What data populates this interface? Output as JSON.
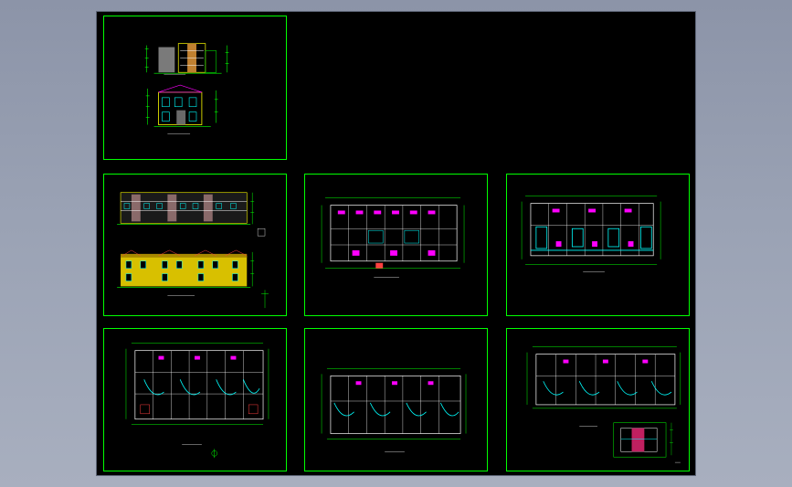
{
  "viewer": {
    "background_color": "#9aa2b4",
    "canvas_color": "#000000",
    "sheet_border_color": "#00ff00"
  },
  "sheets": [
    {
      "id": "sheet-1",
      "kind": "side-elevations"
    },
    {
      "id": "sheet-2",
      "kind": "front-and-rear-elevations"
    },
    {
      "id": "sheet-3",
      "kind": "floor-plan"
    },
    {
      "id": "sheet-4",
      "kind": "floor-plan"
    },
    {
      "id": "sheet-5",
      "kind": "floor-plan"
    },
    {
      "id": "sheet-6",
      "kind": "floor-plan"
    },
    {
      "id": "sheet-7",
      "kind": "floor-plan-with-detail"
    }
  ],
  "colors": {
    "dimension": "#00ff00",
    "wall": "#ffffff",
    "column": "#ff00ff",
    "stair": "#00ffff",
    "facade": "#ffff00",
    "hatch": "#ff4040"
  }
}
